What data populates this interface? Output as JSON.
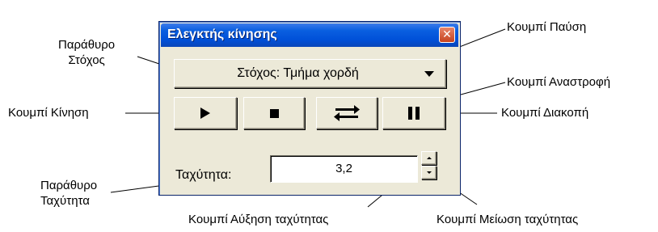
{
  "window": {
    "title": "Ελεγκτής κίνησης",
    "close_glyph": "✕",
    "target_button_label": "Στόχος: Τμήμα χορδή",
    "speed_label": "Ταχύτητα:",
    "speed_value": "3,2"
  },
  "annotations": {
    "target_window_line1": "Παράθυρο",
    "target_window_line2": "Στόχος",
    "move_button": "Κουμπί Κίνηση",
    "pause_button": "Κουμπί Παύση",
    "reverse_button": "Κουμπί Αναστροφή",
    "stop_button": "Κουμπί Διακοπή",
    "speed_window_line1": "Παράθυρο",
    "speed_window_line2": "Ταχύτητα",
    "speed_up_button": "Κουμπί Αύξηση ταχύτητας",
    "speed_down_button": "Κουμπί Μείωση ταχύτητας"
  },
  "icons": {
    "play": "play-icon",
    "pause": "pause-square-icon",
    "reverse": "reverse-arrows-icon",
    "stop": "stop-bars-icon",
    "dropdown": "chevron-down-icon",
    "close": "close-icon"
  }
}
